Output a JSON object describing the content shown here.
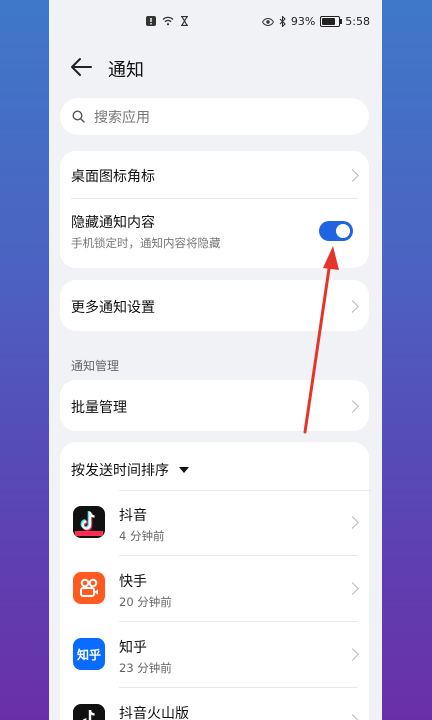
{
  "status": {
    "battery": "93%",
    "battery_level": 0.93,
    "time": "5:58"
  },
  "header": {
    "title": "通知"
  },
  "search": {
    "placeholder": "搜索应用"
  },
  "settings": {
    "badge": "桌面图标角标",
    "hide_content": {
      "label": "隐藏通知内容",
      "sub": "手机锁定时，通知内容将隐藏",
      "enabled": true
    },
    "more": "更多通知设置"
  },
  "section": {
    "label": "通知管理"
  },
  "batch": {
    "label": "批量管理"
  },
  "sort": {
    "label": "按发送时间排序"
  },
  "apps": [
    {
      "name": "抖音",
      "time": "4 分钟前",
      "icon": "douyin-icon"
    },
    {
      "name": "快手",
      "time": "20 分钟前",
      "icon": "kuaishou-icon"
    },
    {
      "name": "知乎",
      "time": "23 分钟前",
      "icon": "zhihu-icon",
      "icon_text": "知乎"
    },
    {
      "name": "抖音火山版",
      "time": "",
      "icon": "douyin-huoshan-icon"
    }
  ],
  "colors": {
    "accent": "#1f64e0",
    "annotation": "#e5352b"
  }
}
